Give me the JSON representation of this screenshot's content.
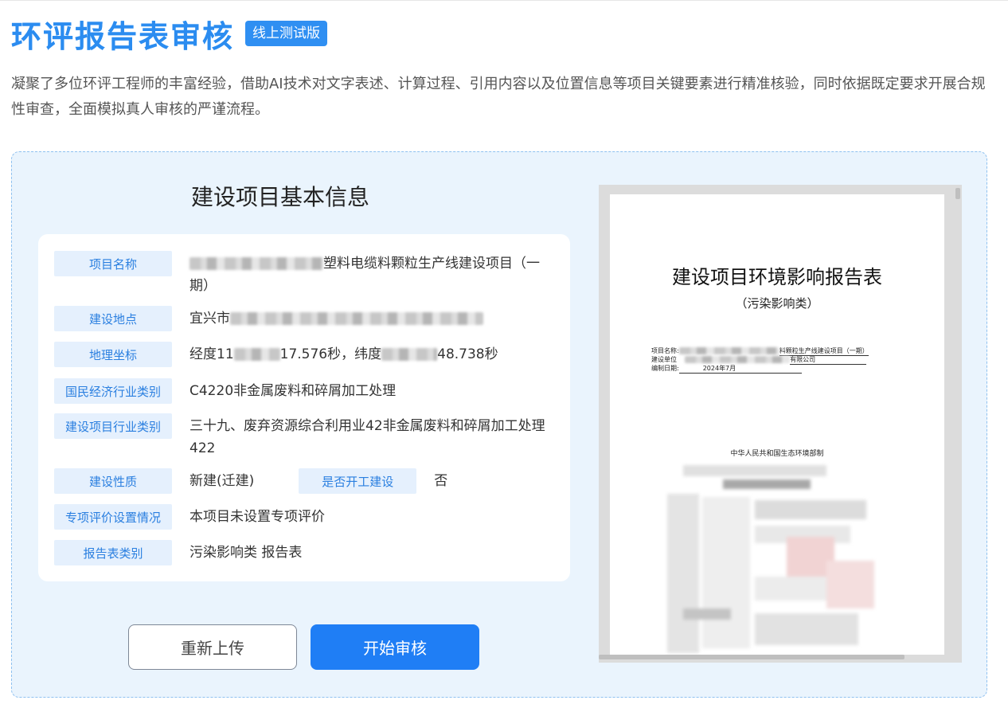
{
  "header": {
    "title": "环评报告表审核",
    "badge": "线上测试版",
    "description": "凝聚了多位环评工程师的丰富经验，借助AI技术对文字表述、计算过程、引用内容以及位置信息等项目关键要素进行精准核验，同时依据既定要求开展合规性审查，全面模拟真人审核的严谨流程。"
  },
  "info": {
    "title": "建设项目基本信息",
    "project_name_label": "项目名称",
    "project_name_value": "塑料电缆料颗粒生产线建设项目（一期）",
    "location_label": "建设地点",
    "location_value": "宜兴市",
    "coords_label": "地理坐标",
    "coords_lon_prefix": "经度11",
    "coords_lon_suffix": "17.576秒，纬度",
    "coords_lat_suffix": "48.738秒",
    "industry_label": "国民经济行业类别",
    "industry_value": "C4220非金属废料和碎屑加工处理",
    "project_industry_label": "建设项目行业类别",
    "project_industry_value": "三十九、废弃资源综合利用业42非金属废料和碎屑加工处理422",
    "nature_label": "建设性质",
    "nature_value": "新建(迁建)",
    "started_label": "是否开工建设",
    "started_value": "否",
    "special_label": "专项评价设置情况",
    "special_value": "本项目未设置专项评价",
    "report_type_label": "报告表类别",
    "report_type_value": "污染影响类 报告表"
  },
  "buttons": {
    "reupload": "重新上传",
    "start": "开始审核"
  },
  "preview": {
    "doc_title": "建设项目环境影响报告表",
    "doc_subtitle": "（污染影响类）",
    "line1_label": "项目名称:",
    "line1_value": "料颗粒生产线建设项目（一期）",
    "line2_label": "建设单位",
    "line2_value": "有限公司",
    "line3_label": "编制日期:",
    "line3_value": "2024年7月",
    "ministry": "中华人民共和国生态环境部制"
  }
}
